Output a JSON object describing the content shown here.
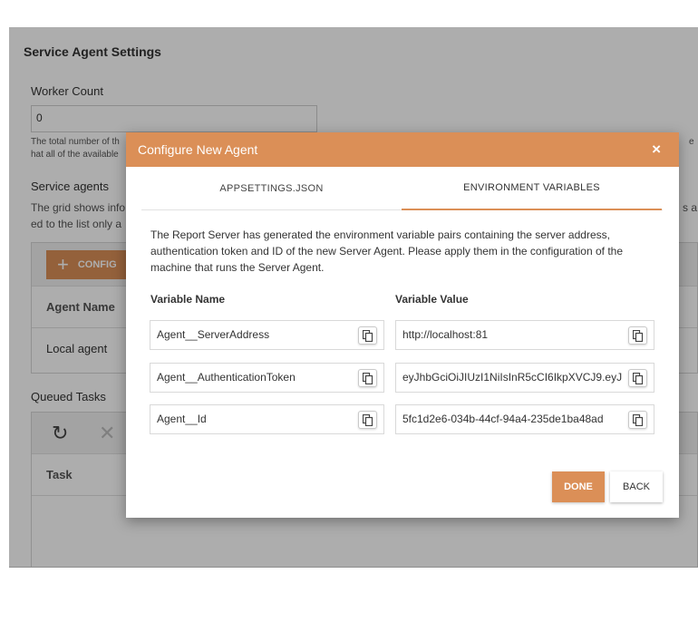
{
  "background": {
    "title": "Service Agent Settings",
    "worker_count_label": "Worker Count",
    "worker_count_value": "0",
    "worker_help_line1": "The total number of th",
    "worker_help_line2": "hat all of the available",
    "worker_help_right": "e",
    "service_agents_label": "Service agents",
    "grid_desc_line1": "The grid shows info",
    "grid_desc_line2": "ed to the list only a",
    "grid_desc_right": "s a",
    "configure_button": "CONFIG",
    "agent_name_header": "Agent Name",
    "agent_row": "Local agent",
    "queued_tasks_label": "Queued Tasks",
    "task_header": "Task"
  },
  "modal": {
    "title": "Configure New Agent",
    "close_symbol": "×",
    "tabs": [
      {
        "label": "APPSETTINGS.JSON",
        "active": false
      },
      {
        "label": "ENVIRONMENT VARIABLES",
        "active": true
      }
    ],
    "description": "The Report Server has generated the environment variable pairs containing the server address, authentication token and ID of the new Server Agent. Please apply them in the configuration of the machine that runs the Server Agent.",
    "col_name": "Variable Name",
    "col_value": "Variable Value",
    "variables": [
      {
        "name": "Agent__ServerAddress",
        "value": "http://localhost:81"
      },
      {
        "name": "Agent__AuthenticationToken",
        "value": "eyJhbGciOiJIUzI1NiIsInR5cCI6IkpXVCJ9.eyJ"
      },
      {
        "name": "Agent__Id",
        "value": "5fc1d2e6-034b-44cf-94a4-235de1ba48ad"
      }
    ],
    "done_label": "DONE",
    "back_label": "BACK"
  },
  "colors": {
    "accent": "#db8f57"
  }
}
